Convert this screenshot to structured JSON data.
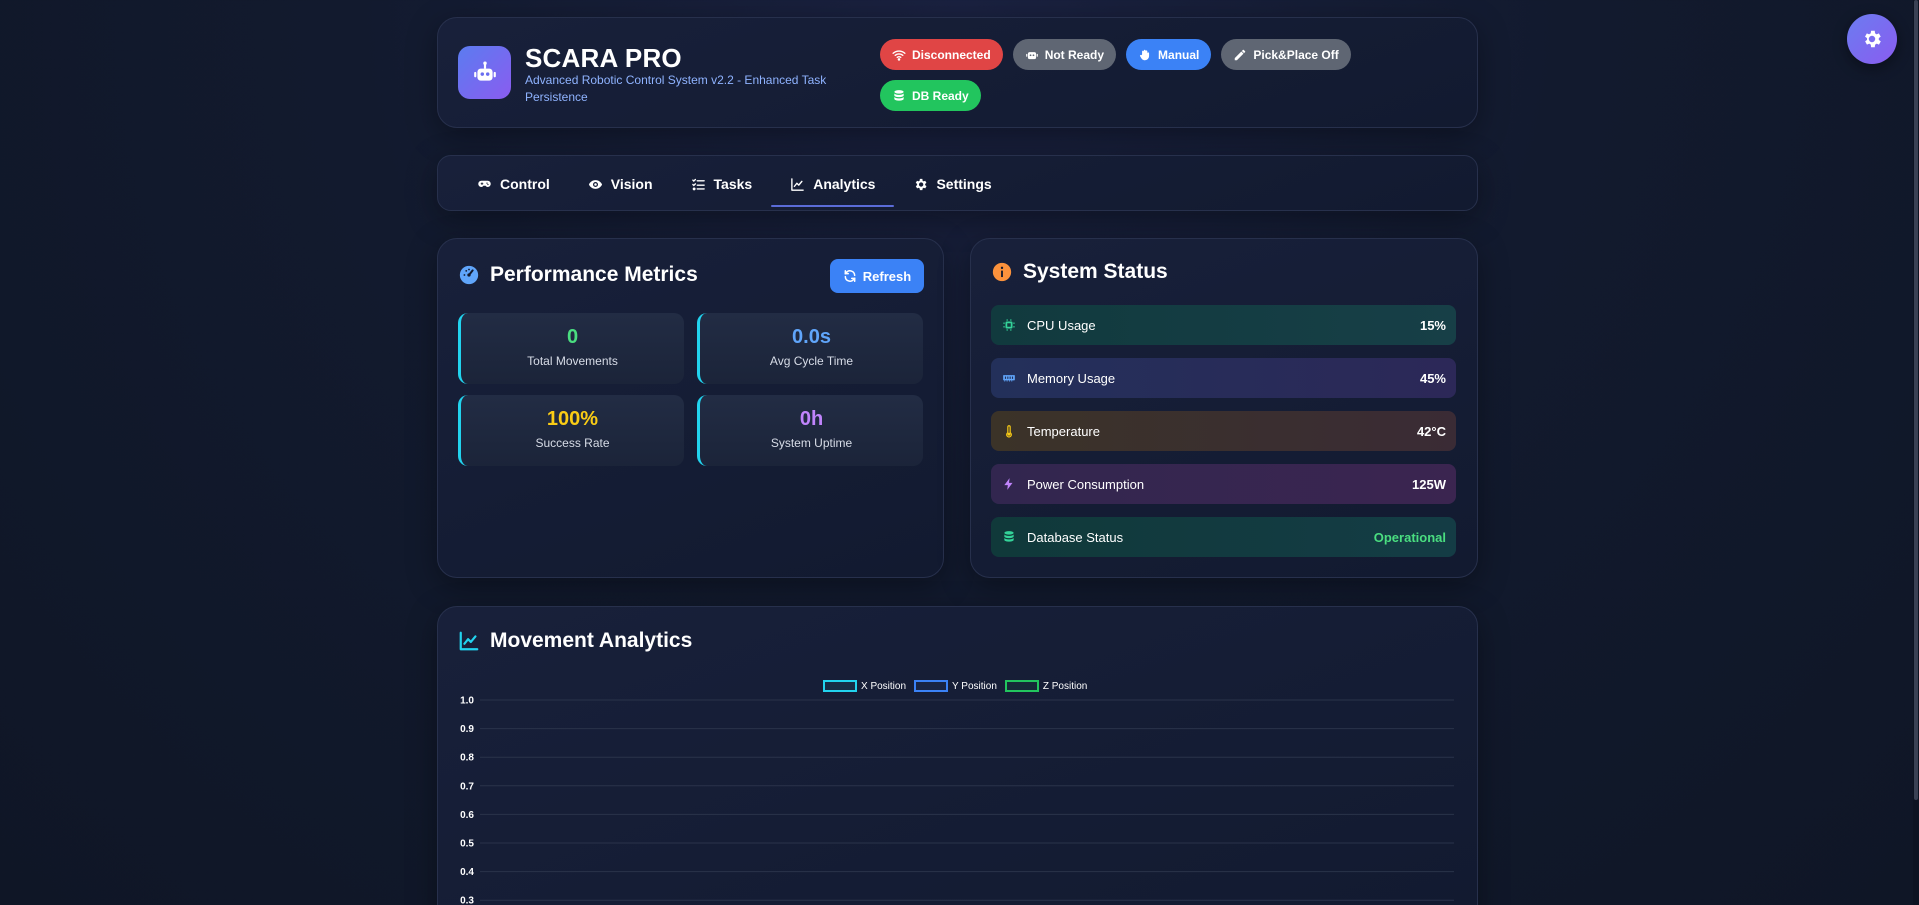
{
  "header": {
    "title": "SCARA PRO",
    "subtitle": "Advanced Robotic Control System v2.2 - Enhanced Task Persistence",
    "badges": [
      {
        "label": "Disconnected",
        "icon": "wifi-icon",
        "color": "#e04545"
      },
      {
        "label": "Not Ready",
        "icon": "robot-icon",
        "color": "#5f6673"
      },
      {
        "label": "Manual",
        "icon": "hand-icon",
        "color": "#3b82f6"
      },
      {
        "label": "Pick&Place Off",
        "icon": "pencil-icon",
        "color": "#5f6673"
      },
      {
        "label": "DB Ready",
        "icon": "database-icon",
        "color": "#22c55e"
      }
    ]
  },
  "tabs": [
    {
      "label": "Control",
      "icon": "gamepad-icon"
    },
    {
      "label": "Vision",
      "icon": "eye-icon"
    },
    {
      "label": "Tasks",
      "icon": "tasks-icon"
    },
    {
      "label": "Analytics",
      "icon": "chart-line-icon",
      "active": true
    },
    {
      "label": "Settings",
      "icon": "gear-icon"
    }
  ],
  "performance": {
    "title": "Performance Metrics",
    "refresh_label": "Refresh",
    "metrics": [
      {
        "value": "0",
        "label": "Total Movements",
        "color": "#4ade80"
      },
      {
        "value": "0.0s",
        "label": "Avg Cycle Time",
        "color": "#60a5fa"
      },
      {
        "value": "100%",
        "label": "Success Rate",
        "color": "#facc15"
      },
      {
        "value": "0h",
        "label": "System Uptime",
        "color": "#c084fc"
      }
    ]
  },
  "system_status": {
    "title": "System Status",
    "rows": [
      {
        "label": "CPU Usage",
        "value": "15%",
        "icon": "microchip-icon"
      },
      {
        "label": "Memory Usage",
        "value": "45%",
        "icon": "memory-icon"
      },
      {
        "label": "Temperature",
        "value": "42°C",
        "icon": "thermometer-icon"
      },
      {
        "label": "Power Consumption",
        "value": "125W",
        "icon": "bolt-icon"
      },
      {
        "label": "Database Status",
        "value": "Operational",
        "icon": "database-icon"
      }
    ]
  },
  "movement": {
    "title": "Movement Analytics"
  },
  "chart_data": {
    "type": "line",
    "series": [
      {
        "name": "X Position",
        "values": [],
        "color": "#22d3ee"
      },
      {
        "name": "Y Position",
        "values": [],
        "color": "#3b82f6"
      },
      {
        "name": "Z Position",
        "values": [],
        "color": "#22c55e"
      }
    ],
    "yticks": [
      "1.0",
      "0.9",
      "0.8",
      "0.7",
      "0.6",
      "0.5",
      "0.4",
      "0.3"
    ],
    "ylim": [
      0,
      1.0
    ],
    "grid": true,
    "legend": "top-center"
  }
}
